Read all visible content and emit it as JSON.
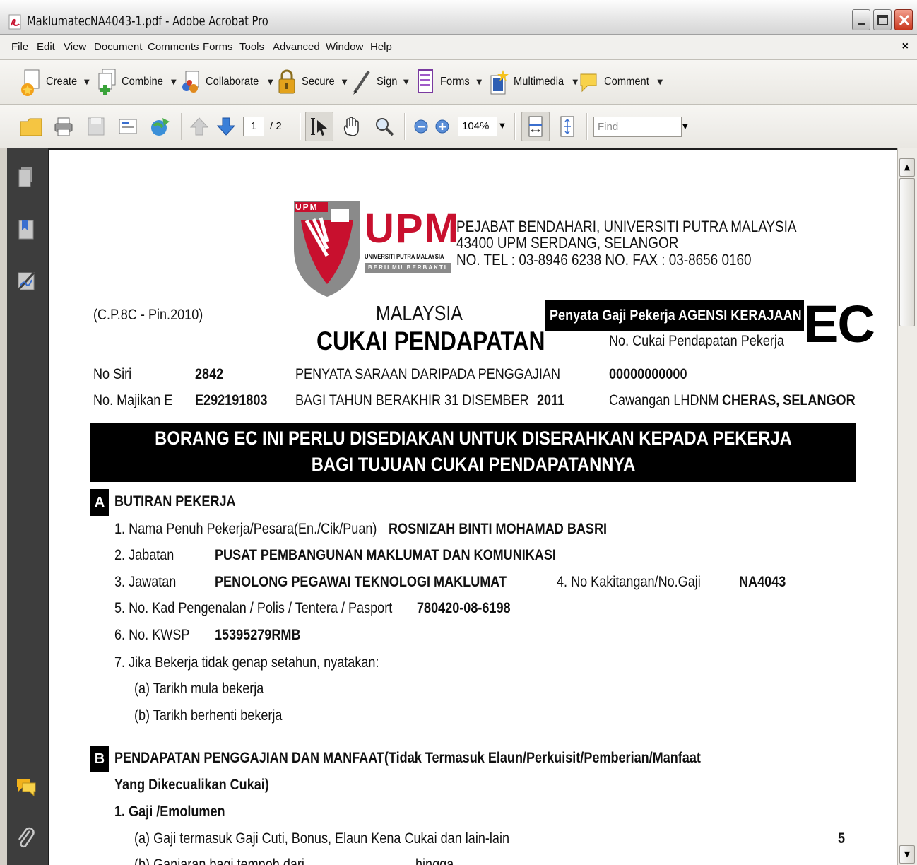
{
  "window": {
    "title": "MaklumatecNA4043-1.pdf - Adobe Acrobat Pro"
  },
  "menubar": {
    "items": [
      "File",
      "Edit",
      "View",
      "Document",
      "Comments",
      "Forms",
      "Tools",
      "Advanced",
      "Window",
      "Help"
    ],
    "close_glyph": "×"
  },
  "tasks": [
    {
      "label": "Create",
      "icon": "create-pdf-icon"
    },
    {
      "label": "Combine",
      "icon": "combine-icon"
    },
    {
      "label": "Collaborate",
      "icon": "collaborate-icon"
    },
    {
      "label": "Secure",
      "icon": "lock-icon"
    },
    {
      "label": "Sign",
      "icon": "pen-icon"
    },
    {
      "label": "Forms",
      "icon": "forms-icon"
    },
    {
      "label": "Multimedia",
      "icon": "multimedia-icon"
    },
    {
      "label": "Comment",
      "icon": "comment-icon"
    }
  ],
  "toolbar": {
    "current_page": "1",
    "total_pages": "/ 2",
    "zoom": "104%",
    "find_placeholder": "Find"
  },
  "document": {
    "header_org": "PEJABAT BENDAHARI, UNIVERSITI PUTRA MALAYSIA",
    "header_addr": "43400 UPM SERDANG, SELANGOR",
    "header_tel": "NO. TEL : 03-8946 6238 NO. FAX : 03-8656 0160",
    "logo_text": "UPM",
    "logo_sub": "UNIVERSITI PUTRA MALAYSIA",
    "logo_motto": "BERILMU BERBAKTI",
    "form_code": "(C.P.8C - Pin.2010)",
    "country": "MALAYSIA",
    "main_title": "CUKAI PENDAPATAN",
    "agensi": "Penyata Gaji Pekerja AGENSI KERAJAAN",
    "ec": "EC",
    "tax_no_label": "No. Cukai Pendapatan Pekerja",
    "tax_no_value": "00000000000",
    "no_siri_label": "No Siri",
    "no_siri_value": "2842",
    "penyata_line": "PENYATA SARAAN DARIPADA PENGGAJIAN",
    "majikan_label": "No. Majikan E",
    "majikan_value": "E292191803",
    "tahun_line": "BAGI TAHUN BERAKHIR 31 DISEMBER",
    "tahun_value": "2011",
    "cawangan_label": "Cawangan LHDNM",
    "cawangan_value": "CHERAS, SELANGOR",
    "banner_line1": "BORANG EC INI PERLU DISEDIAKAN UNTUK DISERAHKAN KEPADA PEKERJA",
    "banner_line2": "BAGI TUJUAN CUKAI PENDAPATANNYA",
    "section_a_letter": "A",
    "section_a_title": "BUTIRAN PEKERJA",
    "a1_label": "1. Nama Penuh Pekerja/Pesara(En./Cik/Puan)",
    "a1_value": "ROSNIZAH BINTI MOHAMAD BASRI",
    "a2_label": "2. Jabatan",
    "a2_value": "PUSAT PEMBANGUNAN MAKLUMAT DAN KOMUNIKASI",
    "a3_label": "3. Jawatan",
    "a3_value": "PENOLONG PEGAWAI TEKNOLOGI MAKLUMAT",
    "a4_label": "4. No Kakitangan/No.Gaji",
    "a4_value": "NA4043",
    "a5_label": "5. No. Kad Pengenalan / Polis / Tentera / Pasport",
    "a5_value": "780420-08-6198",
    "a6_label": "6. No. KWSP",
    "a6_value": "15395279RMB",
    "a7_label": "7. Jika Bekerja tidak genap setahun, nyatakan:",
    "a7a_label": "(a) Tarikh mula bekerja",
    "a7b_label": "(b) Tarikh berhenti bekerja",
    "section_b_letter": "B",
    "section_b_title1": "PENDAPATAN PENGGAJIAN DAN MANFAAT(Tidak Termasuk Elaun/Perkuisit/Pemberian/Manfaat",
    "section_b_title2": "Yang Dikecualikan Cukai)",
    "b1_label": "1. Gaji /Emolumen",
    "b1a_label": "(a) Gaji termasuk Gaji Cuti, Bonus, Elaun Kena Cukai dan lain-lain",
    "b1a_value": "5",
    "b1b_label": "(b) Ganjaran bagi tempoh dari",
    "b1b_mid": "hingga"
  }
}
